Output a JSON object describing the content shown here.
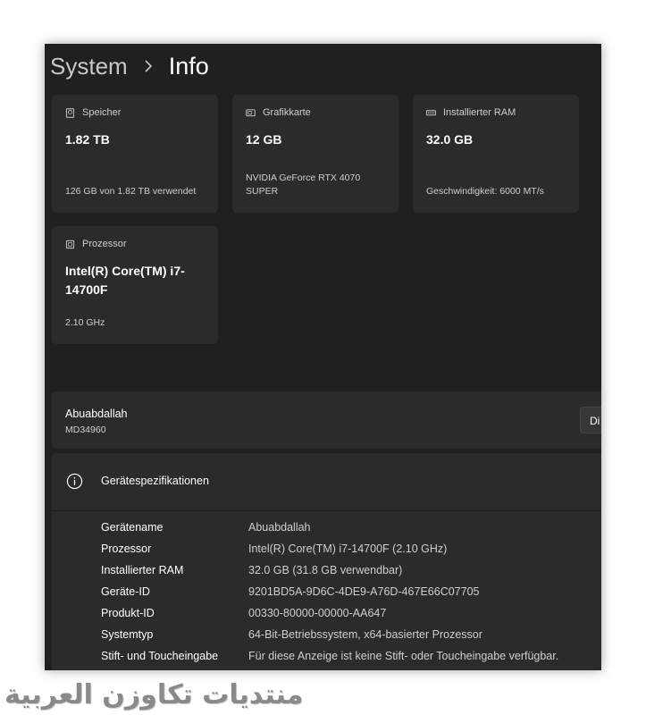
{
  "breadcrumb": {
    "parent": "System",
    "current": "Info"
  },
  "cards": {
    "storage": {
      "title": "Speicher",
      "value": "1.82 TB",
      "sub": "126 GB von 1.82 TB verwendet",
      "icon": "storage-icon"
    },
    "gpu": {
      "title": "Grafikkarte",
      "value": "12 GB",
      "sub": "NVIDIA GeForce RTX 4070 SUPER",
      "icon": "gpu-icon"
    },
    "ram": {
      "title": "Installierter RAM",
      "value": "32.0 GB",
      "sub": "Geschwindigkeit: 6000 MT/s",
      "icon": "ram-icon"
    },
    "cpu": {
      "title": "Prozessor",
      "value": "Intel(R) Core(TM) i7-14700F",
      "sub": "2.10 GHz",
      "icon": "cpu-icon"
    }
  },
  "device": {
    "name": "Abuabdallah",
    "model": "MD34960",
    "rename_label": "Di"
  },
  "specs": {
    "title": "Gerätespezifikationen",
    "rows": [
      {
        "label": "Gerätename",
        "value": "Abuabdallah"
      },
      {
        "label": "Prozessor",
        "value": "Intel(R) Core(TM) i7-14700F (2.10 GHz)"
      },
      {
        "label": "Installierter RAM",
        "value": "32.0 GB (31.8 GB verwendbar)"
      },
      {
        "label": "Geräte-ID",
        "value": "9201BD5A-9D6C-4DE9-A76D-467E66C07705"
      },
      {
        "label": "Produkt-ID",
        "value": "00330-80000-00000-AA647"
      },
      {
        "label": "Systemtyp",
        "value": "64-Bit-Betriebssystem, x64-basierter Prozessor"
      },
      {
        "label": "Stift- und Toucheingabe",
        "value": "Für diese Anzeige ist keine Stift- oder Toucheingabe verfügbar."
      }
    ]
  },
  "watermark": "منتديات تكاوزن العربية",
  "colors": {
    "background": "#202020",
    "card": "#2b2b2b",
    "text": "#ffffff",
    "muted": "#cfcfcf"
  }
}
